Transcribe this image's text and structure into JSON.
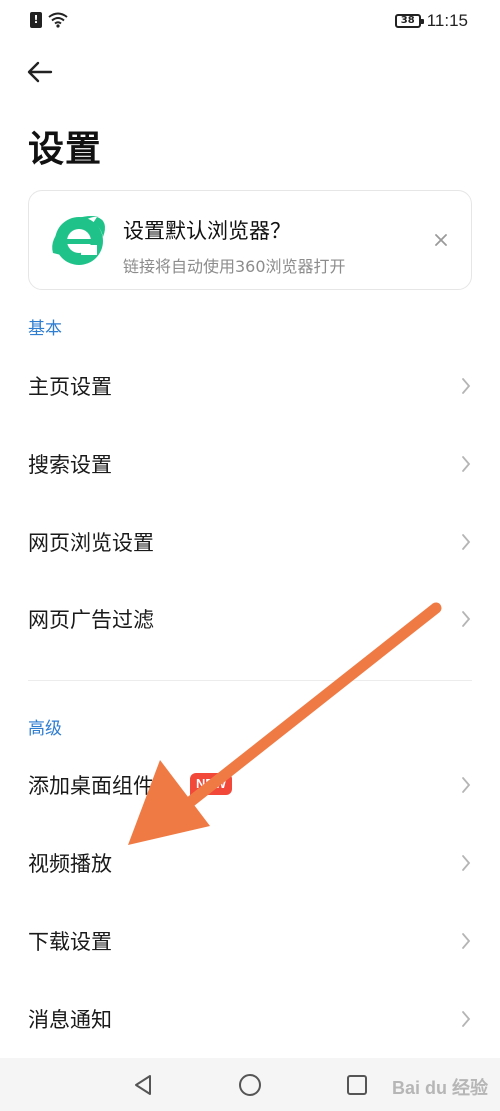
{
  "status_bar": {
    "alert_glyph": "!",
    "battery_level": "38",
    "time": "11:15"
  },
  "header": {
    "title": "设置"
  },
  "banner": {
    "title": "设置默认浏览器？",
    "subtitle": "链接将自动使用360浏览器打开",
    "logo_color": "#1fc38a"
  },
  "sections": {
    "basic": {
      "header": "基本",
      "items": [
        {
          "label": "主页设置"
        },
        {
          "label": "搜索设置"
        },
        {
          "label": "网页浏览设置"
        },
        {
          "label": "网页广告过滤"
        }
      ]
    },
    "advanced": {
      "header": "高级",
      "items": [
        {
          "label": "添加桌面组件",
          "badge": "NEW"
        },
        {
          "label": "视频播放"
        },
        {
          "label": "下载设置"
        },
        {
          "label": "消息通知"
        }
      ]
    }
  },
  "annotation": {
    "color": "#f07a44"
  },
  "watermark": "Bai du 经验",
  "colors": {
    "accent": "#2f7dd1",
    "badge": "#f2483a"
  }
}
